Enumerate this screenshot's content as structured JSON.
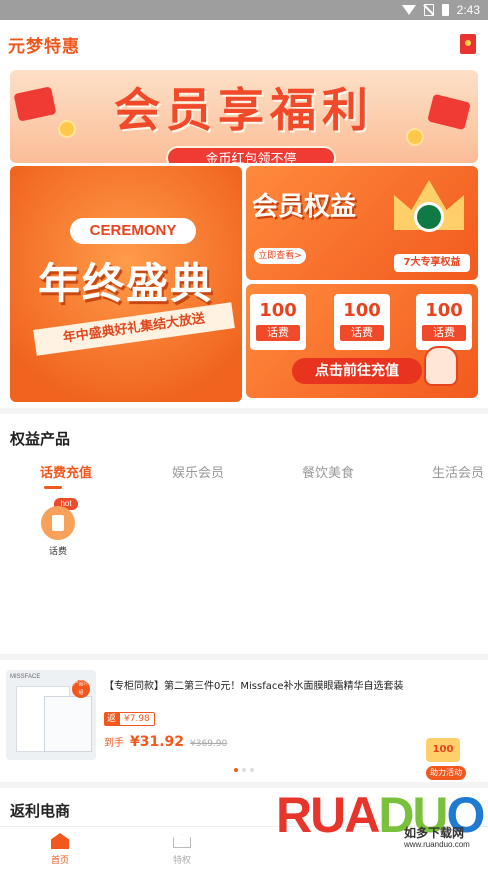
{
  "status_bar": {
    "time": "2:43"
  },
  "app": {
    "title": "元梦特惠"
  },
  "banners": {
    "top_title": "会员享福利",
    "top_pill": "金币红包领不停",
    "left_badge": "CEREMONY",
    "left_title": "年终盛典",
    "left_ribbon": "年中盛典好礼集结大放送",
    "r1_title": "会员权益",
    "r1_button": "立即查看>",
    "r1_tag": "7大专享权益",
    "r2_cards": [
      {
        "value": "100",
        "label": "话费"
      },
      {
        "value": "100",
        "label": "话费"
      },
      {
        "value": "100",
        "label": "话费"
      }
    ],
    "r2_button": "点击前往充值"
  },
  "rights": {
    "section_title": "权益产品",
    "tabs": [
      "话费充值",
      "娱乐会员",
      "餐饮美食",
      "生活会员"
    ],
    "products": [
      {
        "label": "话费",
        "badge": "hot"
      }
    ]
  },
  "goods": {
    "brand": "MISSFACE",
    "img_tag": "产品介绍",
    "title": "【专柜同款】第二第三件0元！Missface补水面膜眼霜精华自选套装",
    "cashback_prefix": "返",
    "cashback_amount": "¥7.98",
    "price_label": "到手",
    "price": "¥31.92",
    "original_price": "¥369.90",
    "float_value": "100",
    "float_label": "助力活动"
  },
  "ecommerce": {
    "section_title": "返利电商"
  },
  "bottom_nav": [
    {
      "label": "首页",
      "active": true
    },
    {
      "label": "特权",
      "active": false
    }
  ],
  "watermark": {
    "text": "RUANDUO",
    "cn": "如多下载网",
    "url": "www.ruanduo.com"
  },
  "colors": {
    "accent": "#f2581e",
    "banner_red": "#ef3b34"
  }
}
